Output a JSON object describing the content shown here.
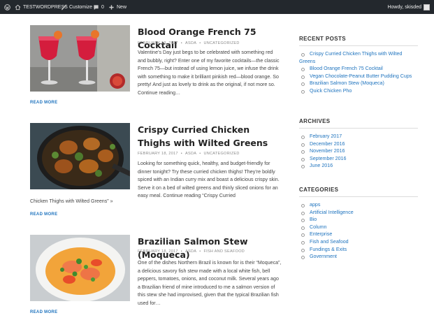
{
  "adminbar": {
    "wp_logo_icon": "wordpress-logo-icon",
    "site_name": "TESTWORDPRESS",
    "customize": "Customize",
    "comments_count": "0",
    "new_label": "New",
    "howdy": "Howdy, skisded"
  },
  "posts": [
    {
      "title": "Blood Orange French 75 Cocktail",
      "date": "FEBRUARY 18, 2017",
      "author": "ASDA",
      "category": "UNCATEGORIZED",
      "excerpt": "Valentine’s Day just begs to be celebrated with something red and bubbly, right? Enter one of my favorite cocktails—the classic French 75—but instead of using lemon juice, we infuse the drink with something to make it brilliant pinkish red—blood orange. So pretty! And just as lovely to drink as the original, if not more so. Continue reading…",
      "read_more": "READ MORE"
    },
    {
      "title": "Crispy Curried Chicken Thighs with Wilted Greens",
      "date": "FEBRUARY 18, 2017",
      "author": "ASDA",
      "category": "UNCATEGORIZED",
      "excerpt": "Looking for something quick, healthy, and budget-friendly for dinner tonight? Try these curried chicken thighs! They’re boldly spiced with an Indian curry mix and boast a delicious crispy skin. Serve it on a bed of wilted greens and thinly sliced onions for an easy meal. Continue reading “Crispy Curried",
      "excerpt_tail": "Chicken Thighs with Wilted Greens” »",
      "read_more": "READ MORE"
    },
    {
      "title": "Brazilian Salmon Stew (Moqueca)",
      "date": "FEBRUARY 18, 2017",
      "author": "ASDA",
      "category": "FISH AND SEAFOOD",
      "excerpt": "One of the dishes Northern Brazil is known for is their “Moqueca”, a delicious savory fish stew made with a local white fish, bell peppers, tomatoes, onions, and coconut milk. Several years ago a Brazilian friend of mine introduced to me a salmon version of this stew she had improvised, given that the typical Brazilian fish used for…",
      "read_more": "READ MORE"
    }
  ],
  "sidebar": {
    "recent_title": "RECENT POSTS",
    "recent": [
      "Crispy Curried Chicken Thighs with Wilted Greens",
      "Blood Orange French 75 Cocktail",
      "Vegan Chocolate-Peanut Butter Pudding Cups",
      "Brazilian Salmon Stew (Moqueca)",
      "Quick Chicken Pho"
    ],
    "archives_title": "ARCHIVES",
    "archives": [
      "February 2017",
      "December 2016",
      "November 2016",
      "September 2016",
      "June 2016"
    ],
    "categories_title": "CATEGORIES",
    "categories": [
      "apps",
      "Artificial Intelligence",
      "Bio",
      "Column",
      "Enterprise",
      "Fish and Seafood",
      "Fundings & Exits",
      "Government"
    ]
  }
}
